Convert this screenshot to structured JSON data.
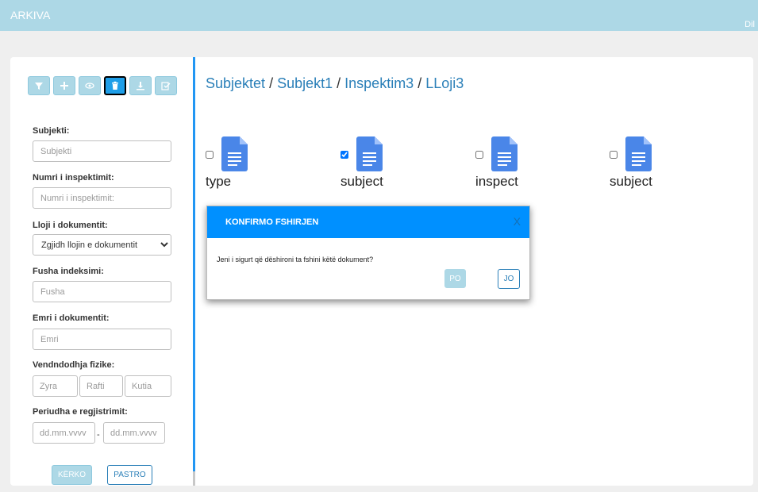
{
  "app": {
    "title": "ARKIVA",
    "user_link": "Dil"
  },
  "toolbar": {
    "icons": [
      "filter-icon",
      "add-icon",
      "view-icon",
      "delete-icon",
      "download-icon",
      "edit-icon"
    ],
    "active": "delete-icon"
  },
  "sidebar": {
    "subjekti": {
      "label": "Subjekti:",
      "placeholder": "Subjekti",
      "value": ""
    },
    "numri": {
      "label": "Numri i inspektimit:",
      "placeholder": "Numri i inspektimit:",
      "value": ""
    },
    "lloji": {
      "label": "Lloji i dokumentit:",
      "selected": "Zgjidh llojin e dokumentit"
    },
    "fusha": {
      "label": "Fusha indeksimi:",
      "placeholder": "Fusha",
      "value": ""
    },
    "emri": {
      "label": "Emri i dokumentit:",
      "placeholder": "Emri",
      "value": ""
    },
    "vendndodhja": {
      "label": "Vendndodhja fizike:",
      "zyra_placeholder": "Zyra",
      "rafti_placeholder": "Rafti",
      "kutia_placeholder": "Kutia"
    },
    "periudha": {
      "label": "Periudha e regjistrimit:",
      "from_placeholder": "dd.mm.vvvv",
      "separator": "-",
      "to_placeholder": "dd.mm.vvvv"
    },
    "search_label": "KËRKO",
    "clear_label": "PASTRO"
  },
  "breadcrumb": {
    "items": [
      "Subjektet",
      "Subjekt1",
      "Inspektim3",
      "LLoji3"
    ],
    "separator": "/"
  },
  "documents": [
    {
      "name": "type",
      "checked": false
    },
    {
      "name": "subject",
      "checked": true
    },
    {
      "name": "inspect",
      "checked": false
    },
    {
      "name": "subject",
      "checked": false
    }
  ],
  "modal": {
    "title": "KONFIRMO FSHIRJEN",
    "close": "X",
    "message": "Jeni i sigurt që dëshironi ta fshini këtë dokument?",
    "yes_label": "PO",
    "no_label": "JO"
  },
  "colors": {
    "topbar": "#add8e6",
    "accent": "#2196f3",
    "link": "#2a7fb8",
    "modal_header": "#0090ff",
    "doc_icon": "#4a86e8"
  }
}
